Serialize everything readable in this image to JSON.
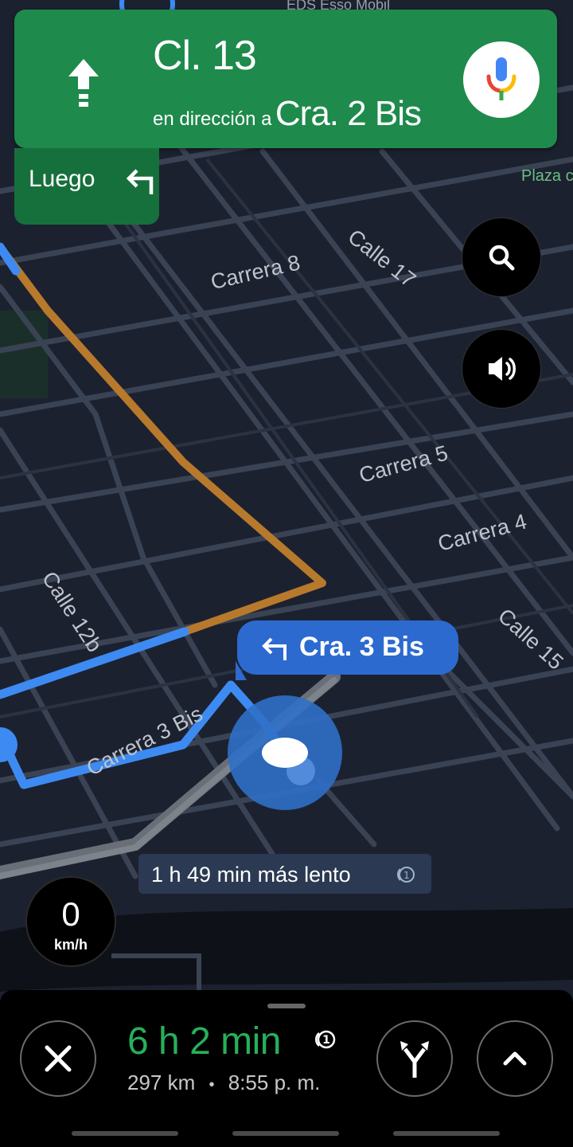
{
  "navigation": {
    "street": "Cl. 13",
    "direction_prefix": "en dirección a",
    "direction_street": "Cra. 2 Bis",
    "then_label": "Luego",
    "maneuver_icon": "straight-arrow-icon",
    "then_icon": "turn-left-icon"
  },
  "map": {
    "labels": {
      "carrera8": "Carrera 8",
      "calle17": "Calle 17",
      "carrera5": "Carrera 5",
      "carrera4": "Carrera 4",
      "calle12b": "Calle 12b",
      "calle15": "Calle 15",
      "carrera3bis": "Carrera 3 Bis",
      "plaza": "Plaza c",
      "poi_top": "EDS Esso Mobil"
    },
    "next_turn": "Cra. 3 Bis",
    "slower_route": "1 h 49 min más lento"
  },
  "speed": {
    "value": "0",
    "unit": "km/h"
  },
  "trip": {
    "duration": "6 h 2 min",
    "distance": "297 km",
    "separator": "•",
    "arrival": "8:55 p. m."
  },
  "colors": {
    "header_green": "#1e8a4c",
    "route_blue": "#3d8bf2",
    "alt_route_orange": "#b7792c",
    "eta_green": "#26b05a",
    "map_background": "#1c2130"
  }
}
